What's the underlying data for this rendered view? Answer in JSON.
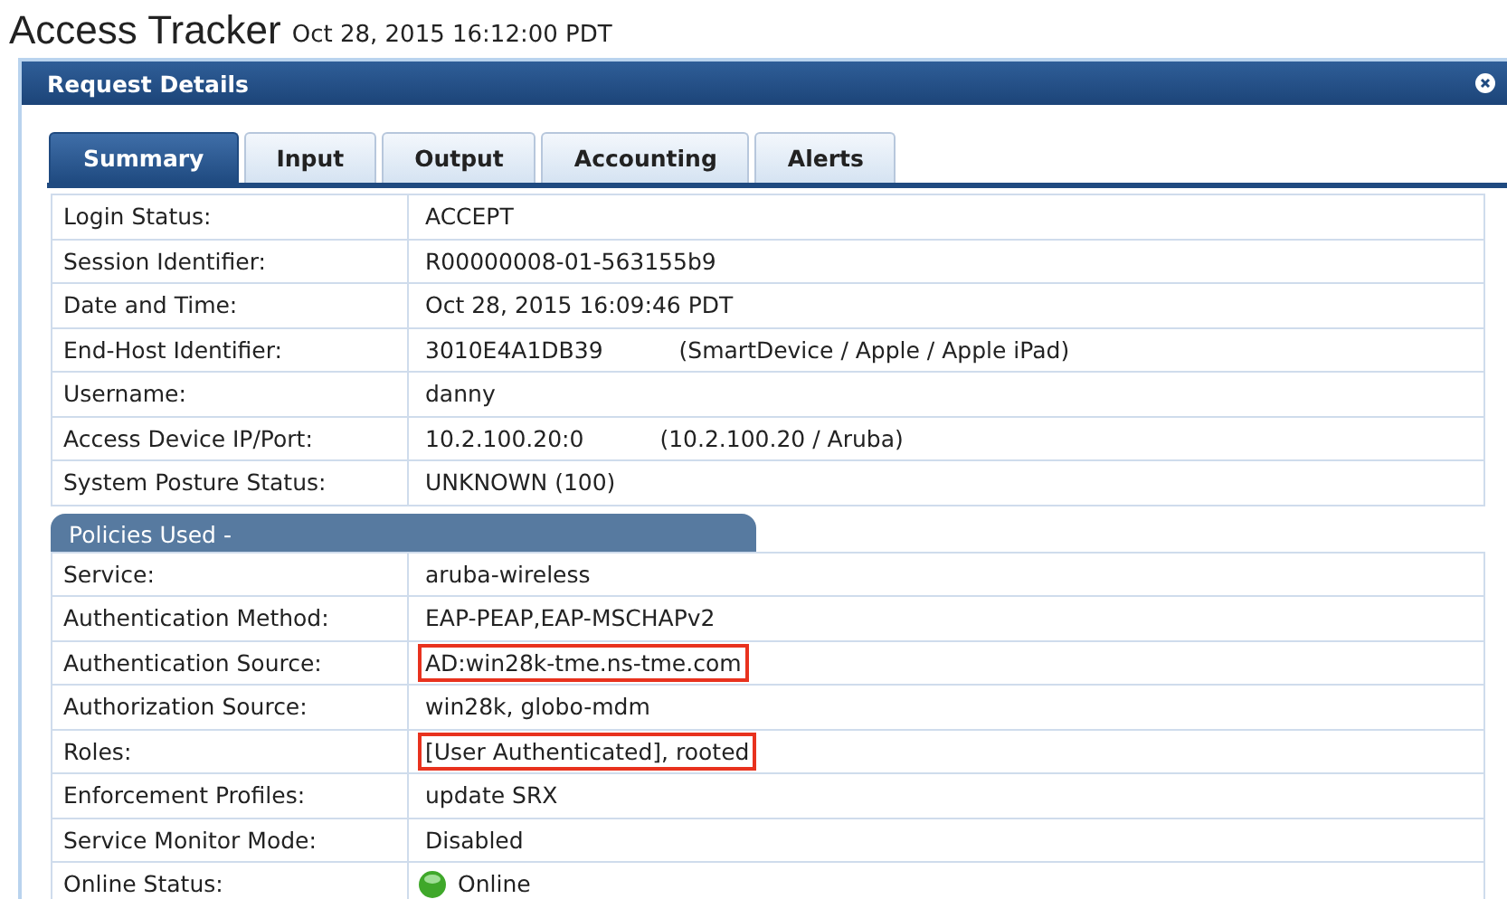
{
  "page": {
    "title": "Access Tracker",
    "timestamp": "Oct 28, 2015 16:12:00 PDT"
  },
  "dialog": {
    "title": "Request Details",
    "tabs": [
      {
        "label": "Summary",
        "selected": true
      },
      {
        "label": "Input",
        "selected": false
      },
      {
        "label": "Output",
        "selected": false
      },
      {
        "label": "Accounting",
        "selected": false
      },
      {
        "label": "Alerts",
        "selected": false
      }
    ],
    "summary_rows": [
      {
        "label": "Login Status:",
        "value": "ACCEPT"
      },
      {
        "label": "Session Identifier:",
        "value": "R00000008-01-563155b9"
      },
      {
        "label": "Date and Time:",
        "value": "Oct 28, 2015 16:09:46 PDT"
      },
      {
        "label": "End-Host Identifier:",
        "value": "3010E4A1DB39",
        "detail": "(SmartDevice / Apple / Apple iPad)"
      },
      {
        "label": "Username:",
        "value": "danny"
      },
      {
        "label": "Access Device IP/Port:",
        "value": "10.2.100.20:0",
        "detail": "(10.2.100.20 / Aruba)"
      },
      {
        "label": "System Posture Status:",
        "value": "UNKNOWN (100)"
      }
    ],
    "policies_heading": "Policies Used -",
    "policy_rows": [
      {
        "label": "Service:",
        "value": "aruba-wireless",
        "highlighted": false
      },
      {
        "label": "Authentication Method:",
        "value": "EAP-PEAP,EAP-MSCHAPv2",
        "highlighted": false
      },
      {
        "label": "Authentication Source:",
        "value": "AD:win28k-tme.ns-tme.com",
        "highlighted": true
      },
      {
        "label": "Authorization Source:",
        "value": "win28k, globo-mdm",
        "highlighted": false
      },
      {
        "label": "Roles:",
        "value": "[User Authenticated], rooted",
        "highlighted": true
      },
      {
        "label": "Enforcement Profiles:",
        "value": "update SRX",
        "highlighted": false
      },
      {
        "label": "Service Monitor Mode:",
        "value": "Disabled",
        "highlighted": false
      },
      {
        "label": "Online Status:",
        "value": "Online",
        "highlighted": false,
        "online": true
      }
    ]
  }
}
